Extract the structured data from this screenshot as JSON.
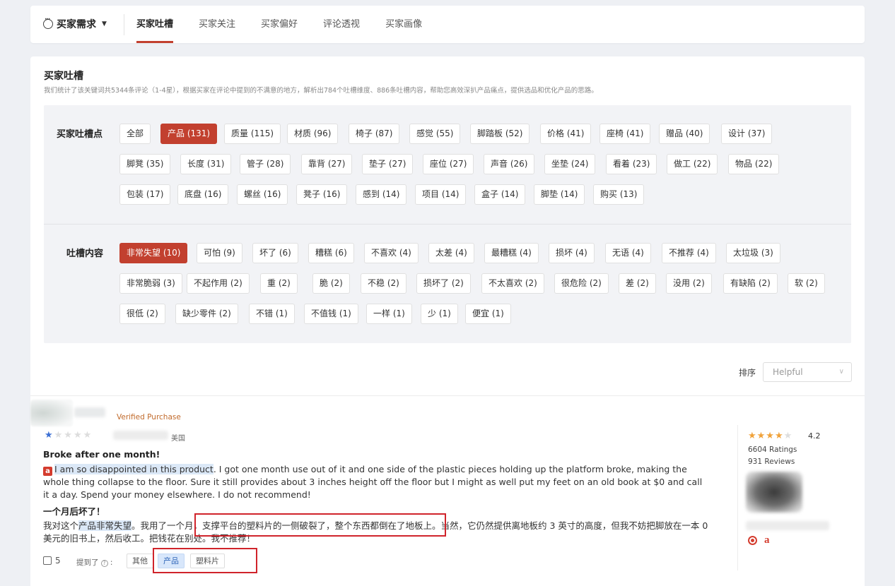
{
  "nav": {
    "needs_label": "买家需求",
    "tabs": [
      {
        "label": "买家吐槽",
        "active": true
      },
      {
        "label": "买家关注",
        "active": false
      },
      {
        "label": "买家偏好",
        "active": false
      },
      {
        "label": "评论透视",
        "active": false
      },
      {
        "label": "买家画像",
        "active": false
      }
    ]
  },
  "section": {
    "title": "买家吐槽",
    "description": "我们统计了该关键词共5344条评论（1-4星），根据买家在评论中提到的不满意的地方，解析出784个吐槽维度、886条吐槽内容，帮助您高效深扒产品痛点，提供选品和优化产品的思路。"
  },
  "points": {
    "label": "买家吐槽点",
    "tags": [
      "全部",
      "产品 (131)",
      "质量 (115)",
      "材质 (96)",
      "椅子 (87)",
      "感觉 (55)",
      "脚踏板 (52)",
      "价格 (41)",
      "座椅 (41)",
      "赠品 (40)",
      "设计 (37)",
      "脚凳 (35)",
      "长度 (31)",
      "管子 (28)",
      "靠背 (27)",
      "垫子 (27)",
      "座位 (27)",
      "声音 (26)",
      "坐垫 (24)",
      "看着 (23)",
      "做工 (22)",
      "物品 (22)",
      "包装 (17)",
      "底盘 (16)",
      "螺丝 (16)",
      "凳子 (16)",
      "感到 (14)",
      "项目 (14)",
      "盒子 (14)",
      "脚垫 (14)",
      "购买 (13)"
    ],
    "selected": "产品 (131)"
  },
  "contents": {
    "label": "吐槽内容",
    "tags": [
      "非常失望 (10)",
      "可怕 (9)",
      "坏了 (6)",
      "糟糕 (6)",
      "不喜欢 (4)",
      "太差 (4)",
      "最糟糕 (4)",
      "损坏 (4)",
      "无语 (4)",
      "不推荐 (4)",
      "太垃圾 (3)",
      "非常脆弱 (3)",
      "不起作用 (2)",
      "重 (2)",
      "脆 (2)",
      "不稳 (2)",
      "损坏了 (2)",
      "不太喜欢 (2)",
      "很危险 (2)",
      "差 (2)",
      "没用 (2)",
      "有缺陷 (2)",
      "软 (2)",
      "很低 (2)",
      "缺少零件 (2)",
      "不错 (1)",
      "不值钱 (1)",
      "一样 (1)",
      "少 (1)",
      "便宜 (1)"
    ],
    "selected": "非常失望 (10)"
  },
  "sort": {
    "label": "排序",
    "value": "Helpful"
  },
  "review": {
    "verified": "Verified Purchase",
    "rating": 1,
    "country": "美国",
    "title": "Broke after one month!",
    "amazon_badge": "a",
    "highlight": "I am so disappointed in this product",
    "body_rest": ". I got one month use out of it and one side of the plastic pieces holding up the platform broke, making the whole thing collapse to the floor. Sure it still provides about 3 inches height off the floor but I might as well put my feet on an old book at $0 and call it a day. Spend your money elsewhere. I do not recommend!",
    "cn_title": "一个月后坏了！",
    "cn_pre": "我对这个",
    "cn_highlight": "产品非常失望",
    "cn_rest": "。我用了一个月，支撑平台的塑料片的一侧破裂了，整个东西都倒在了地板上。当然，它仍然提供离地板约 3 英寸的高度，但我不妨把脚放在一本 0 美元的旧书上，然后收工。把钱花在别处。我不推荐！",
    "likes": "5",
    "mentioned_label": "提到了",
    "mention_tags": [
      "其他",
      "产品",
      "塑料片"
    ]
  },
  "product": {
    "rating": "4.2",
    "ratings_text": "6604 Ratings",
    "reviews_text": "931 Reviews"
  },
  "colors": {
    "accent": "#c2402f",
    "highlight": "#dbe8f7",
    "star": "#f0a23a",
    "annotation_box": "#d0242b"
  }
}
